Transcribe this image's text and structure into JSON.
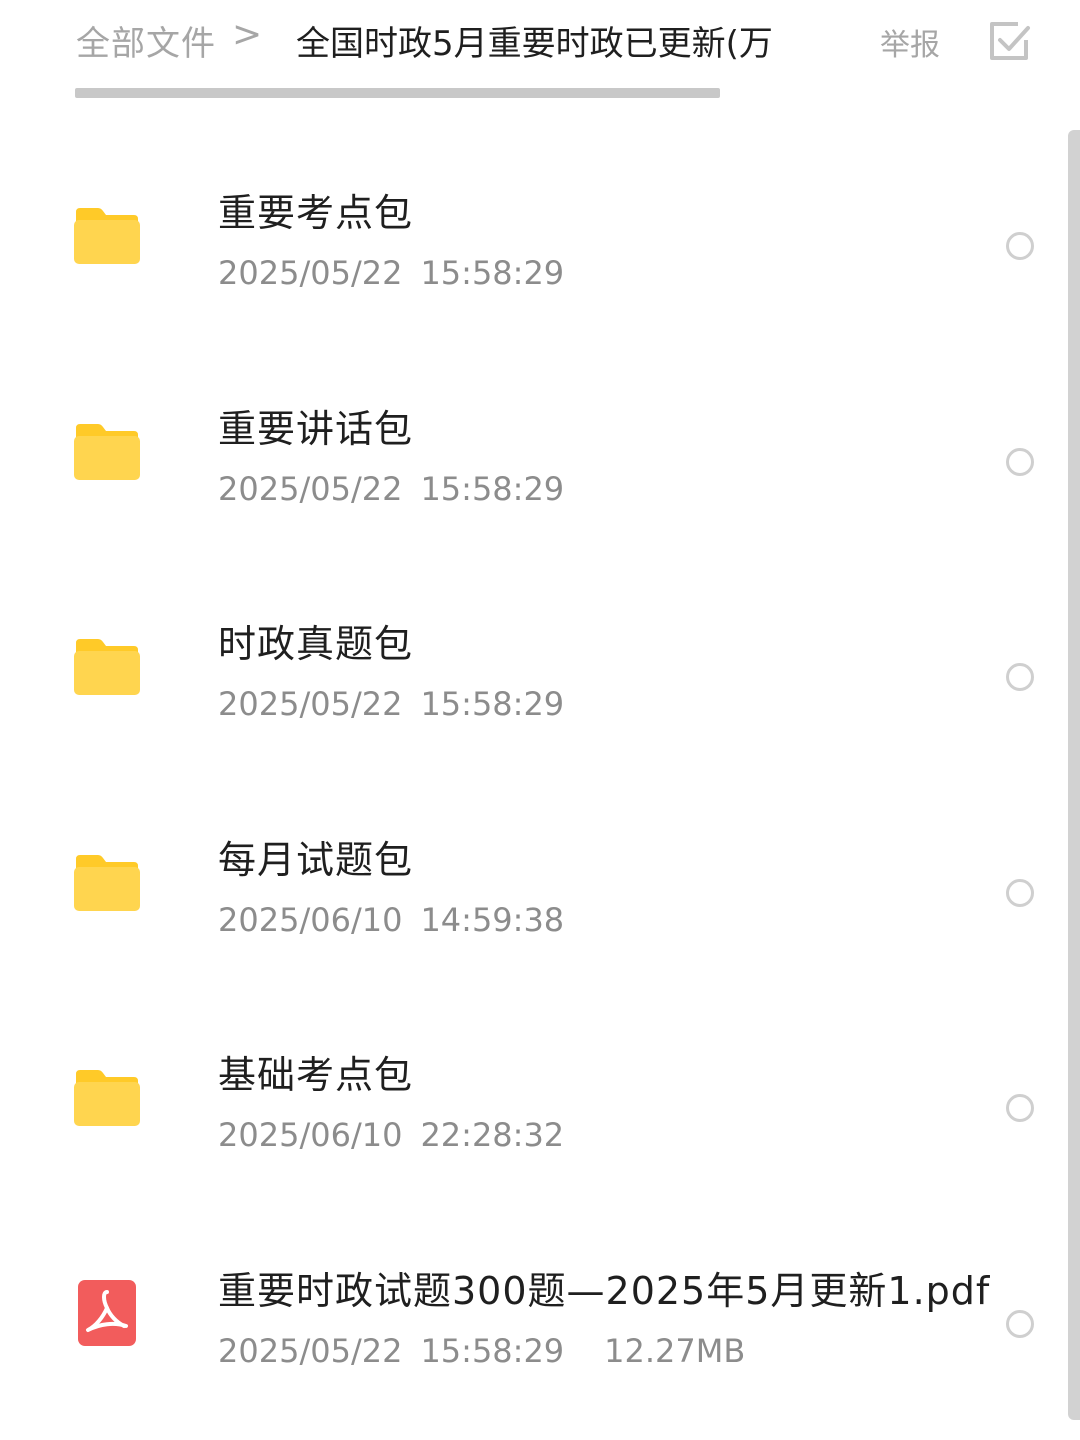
{
  "header": {
    "breadcrumb_root": "全部文件",
    "breadcrumb_separator": ">",
    "breadcrumb_current": "全国时政5月重要时政已更新(万",
    "report_label": "举报",
    "select_icon": "checkbox-check-icon"
  },
  "colors": {
    "folder": "#FFD54F",
    "folder_tab": "#FFCA28",
    "pdf": "#F25C5C",
    "muted_text": "#8C8C8C",
    "primary_text": "#1F1F1F"
  },
  "files": [
    {
      "name": "重要考点包",
      "date": "2025/05/22",
      "time": "15:58:29",
      "size": "",
      "icon": "folder-icon"
    },
    {
      "name": "重要讲话包",
      "date": "2025/05/22",
      "time": "15:58:29",
      "size": "",
      "icon": "folder-icon"
    },
    {
      "name": "时政真题包",
      "date": "2025/05/22",
      "time": "15:58:29",
      "size": "",
      "icon": "folder-icon"
    },
    {
      "name": "每月试题包",
      "date": "2025/06/10",
      "time": "14:59:38",
      "size": "",
      "icon": "folder-icon"
    },
    {
      "name": "基础考点包",
      "date": "2025/06/10",
      "time": "22:28:32",
      "size": "",
      "icon": "folder-icon"
    },
    {
      "name": "重要时政试题300题—2025年5月更新1.pdf",
      "date": "2025/05/22",
      "time": "15:58:29",
      "size": "12.27MB",
      "icon": "pdf-icon"
    }
  ]
}
